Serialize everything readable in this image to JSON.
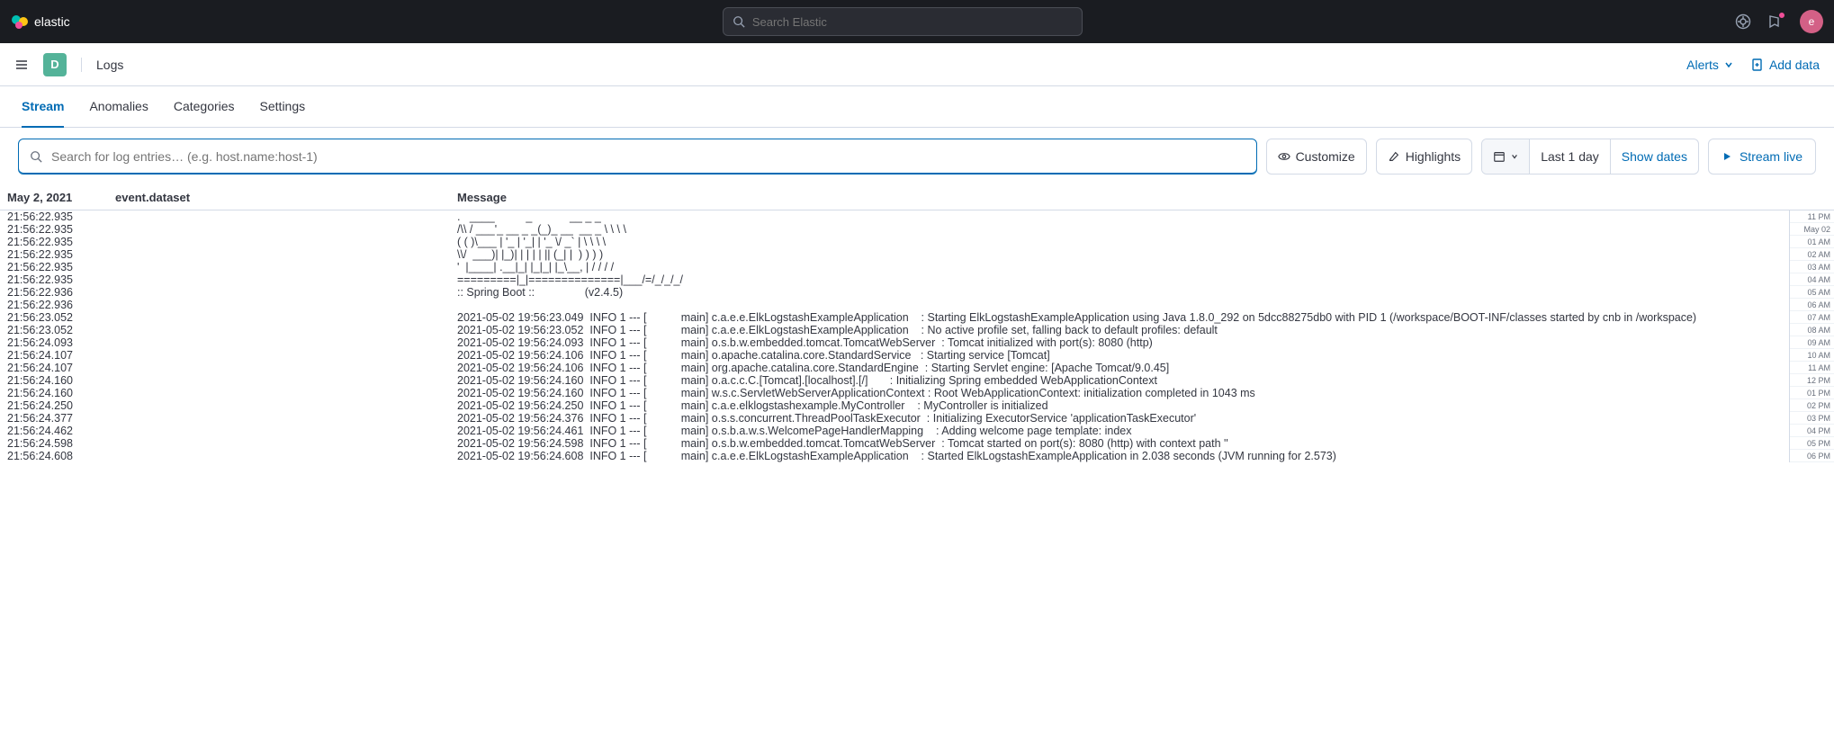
{
  "brand": "elastic",
  "search_placeholder": "Search Elastic",
  "avatar_letter": "e",
  "space_letter": "D",
  "breadcrumb": "Logs",
  "actions": {
    "alerts": "Alerts",
    "add_data": "Add data"
  },
  "tabs": [
    {
      "key": "stream",
      "label": "Stream",
      "active": true
    },
    {
      "key": "anomalies",
      "label": "Anomalies",
      "active": false
    },
    {
      "key": "categories",
      "label": "Categories",
      "active": false
    },
    {
      "key": "settings",
      "label": "Settings",
      "active": false
    }
  ],
  "query_placeholder": "Search for log entries… (e.g. host.name:host-1)",
  "toolbar": {
    "customize": "Customize",
    "highlights": "Highlights",
    "time_range": "Last 1 day",
    "show_dates": "Show dates",
    "stream_live": "Stream live"
  },
  "columns": {
    "date_label": "May 2, 2021",
    "dataset": "event.dataset",
    "message": "Message"
  },
  "log_rows": [
    {
      "ts": "21:56:22.935",
      "msg": ".   ____          _            __ _ _"
    },
    {
      "ts": "21:56:22.935",
      "msg": "/\\\\ / ___'_ __ _ _(_)_ __  __ _ \\ \\ \\ \\"
    },
    {
      "ts": "21:56:22.935",
      "msg": "( ( )\\___ | '_ | '_| | '_ \\/ _` | \\ \\ \\ \\"
    },
    {
      "ts": "21:56:22.935",
      "msg": "\\\\/  ___)| |_)| | | | | || (_| |  ) ) ) )"
    },
    {
      "ts": "21:56:22.935",
      "msg": "'  |____| .__|_| |_|_| |_\\__, | / / / /"
    },
    {
      "ts": "21:56:22.935",
      "msg": "=========|_|==============|___/=/_/_/_/"
    },
    {
      "ts": "21:56:22.936",
      "msg": ":: Spring Boot ::                (v2.4.5)"
    },
    {
      "ts": "21:56:22.936",
      "msg": ""
    },
    {
      "ts": "21:56:23.052",
      "msg": "2021-05-02 19:56:23.049  INFO 1 --- [           main] c.a.e.e.ElkLogstashExampleApplication    : Starting ElkLogstashExampleApplication using Java 1.8.0_292 on 5dcc88275db0 with PID 1 (/workspace/BOOT-INF/classes started by cnb in /workspace)"
    },
    {
      "ts": "21:56:23.052",
      "msg": "2021-05-02 19:56:23.052  INFO 1 --- [           main] c.a.e.e.ElkLogstashExampleApplication    : No active profile set, falling back to default profiles: default"
    },
    {
      "ts": "21:56:24.093",
      "msg": "2021-05-02 19:56:24.093  INFO 1 --- [           main] o.s.b.w.embedded.tomcat.TomcatWebServer  : Tomcat initialized with port(s): 8080 (http)"
    },
    {
      "ts": "21:56:24.107",
      "msg": "2021-05-02 19:56:24.106  INFO 1 --- [           main] o.apache.catalina.core.StandardService   : Starting service [Tomcat]"
    },
    {
      "ts": "21:56:24.107",
      "msg": "2021-05-02 19:56:24.106  INFO 1 --- [           main] org.apache.catalina.core.StandardEngine  : Starting Servlet engine: [Apache Tomcat/9.0.45]"
    },
    {
      "ts": "21:56:24.160",
      "msg": "2021-05-02 19:56:24.160  INFO 1 --- [           main] o.a.c.c.C.[Tomcat].[localhost].[/]       : Initializing Spring embedded WebApplicationContext"
    },
    {
      "ts": "21:56:24.160",
      "msg": "2021-05-02 19:56:24.160  INFO 1 --- [           main] w.s.c.ServletWebServerApplicationContext : Root WebApplicationContext: initialization completed in 1043 ms"
    },
    {
      "ts": "21:56:24.250",
      "msg": "2021-05-02 19:56:24.250  INFO 1 --- [           main] c.a.e.elklogstashexample.MyController    : MyController is initialized"
    },
    {
      "ts": "21:56:24.377",
      "msg": "2021-05-02 19:56:24.376  INFO 1 --- [           main] o.s.s.concurrent.ThreadPoolTaskExecutor  : Initializing ExecutorService 'applicationTaskExecutor'"
    },
    {
      "ts": "21:56:24.462",
      "msg": "2021-05-02 19:56:24.461  INFO 1 --- [           main] o.s.b.a.w.s.WelcomePageHandlerMapping    : Adding welcome page template: index"
    },
    {
      "ts": "21:56:24.598",
      "msg": "2021-05-02 19:56:24.598  INFO 1 --- [           main] o.s.b.w.embedded.tomcat.TomcatWebServer  : Tomcat started on port(s): 8080 (http) with context path ''"
    },
    {
      "ts": "21:56:24.608",
      "msg": "2021-05-02 19:56:24.608  INFO 1 --- [           main] c.a.e.e.ElkLogstashExampleApplication    : Started ElkLogstashExampleApplication in 2.038 seconds (JVM running for 2.573)"
    }
  ],
  "minimap_ticks": [
    "11 PM",
    "May 02",
    "01 AM",
    "02 AM",
    "03 AM",
    "04 AM",
    "05 AM",
    "06 AM",
    "07 AM",
    "08 AM",
    "09 AM",
    "10 AM",
    "11 AM",
    "12 PM",
    "01 PM",
    "02 PM",
    "03 PM",
    "04 PM",
    "05 PM",
    "06 PM"
  ]
}
